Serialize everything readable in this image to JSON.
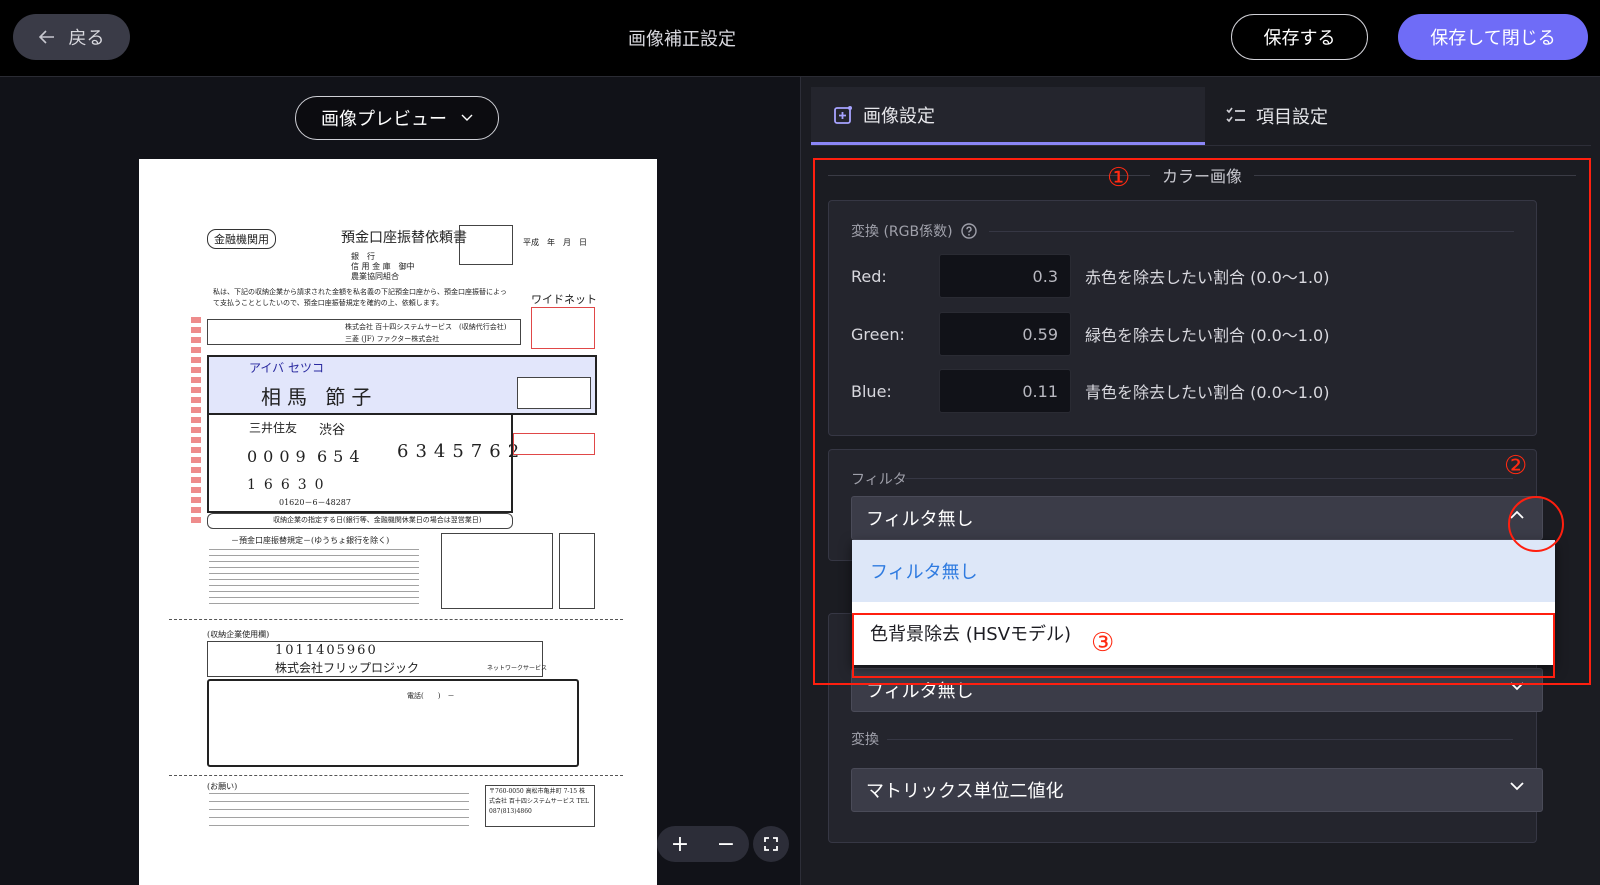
{
  "header": {
    "back_label": "戻る",
    "title": "画像補正設定",
    "save_label": "保存する",
    "save_close_label": "保存して閉じる"
  },
  "preview": {
    "selector_label": "画像プレビュー",
    "zoom_in": "+",
    "zoom_out": "−"
  },
  "document": {
    "badge": "金融機関用",
    "title": "預金口座振替依頼書",
    "date_labels": "平成　年　月　日",
    "bank_lines": [
      "銀　行",
      "信 用 金 庫　御中",
      "農業協同組合"
    ],
    "intro": "私は、下記の収納企業から請求された金額を私名義の下記預金口座から、預金口座振替によって支払うこととしたいので、預金口座振替規定を確約の上、依頼します。",
    "widenet": "ワイドネット",
    "company_1": "株式会社 百十四システムサービス　(収納代行会社)",
    "company_2": "三菱 (JF) ファクター株式会社",
    "furigana": "アイバ セツコ",
    "name": "相馬 節子",
    "bank_name": "三井住友",
    "branch": "渋谷",
    "account_number": "6345762",
    "bank_code": "0009",
    "branch_code": "654",
    "postal_code": "16630",
    "account_sub": "01620－6－48287",
    "transfer_note": "収納企業の指定する日(銀行等、金融機関休業日の場合は翌営業日)",
    "rules_title": "－預金口座振替規定－(ゆうちょ銀行を除く)",
    "company_section": "(収納企業使用欄)",
    "consignor_number": "1011405960",
    "consignor_name": "株式会社フリップロジック",
    "service": "ネットワークサービス",
    "phone_label": "電話(　　)　－",
    "footer_label": "(お願い)",
    "footer_address": "〒760-0050 高松市亀井町 7-15 株式会社 百十四システムサービス TEL 087(813)4860"
  },
  "tabs": [
    {
      "label": "画像設定"
    },
    {
      "label": "項目設定"
    }
  ],
  "color_section": {
    "title": "カラー画像",
    "conversion_label": "変換 (RGB係数)",
    "rows": [
      {
        "name": "Red:",
        "value": "0.3",
        "desc": "赤色を除去したい割合 (0.0〜1.0)"
      },
      {
        "name": "Green:",
        "value": "0.59",
        "desc": "緑色を除去したい割合 (0.0〜1.0)"
      },
      {
        "name": "Blue:",
        "value": "0.11",
        "desc": "青色を除去したい割合 (0.0〜1.0)"
      }
    ]
  },
  "filter_section": {
    "label": "フィルタ",
    "selected": "フィルタ無し",
    "options": [
      "フィルタ無し",
      "色背景除去 (HSVモデル)"
    ]
  },
  "lower_section": {
    "filter_selected": "フィルタ無し",
    "conversion_label": "変換",
    "conversion_selected": "マトリックス単位二値化"
  },
  "annotations": {
    "mark_1": "①",
    "mark_2": "②",
    "mark_3": "③"
  },
  "colors": {
    "accent": "#6f6cf7",
    "annotation_red": "#ff1f0f",
    "dropdown_selected_text": "#2f7be0"
  }
}
